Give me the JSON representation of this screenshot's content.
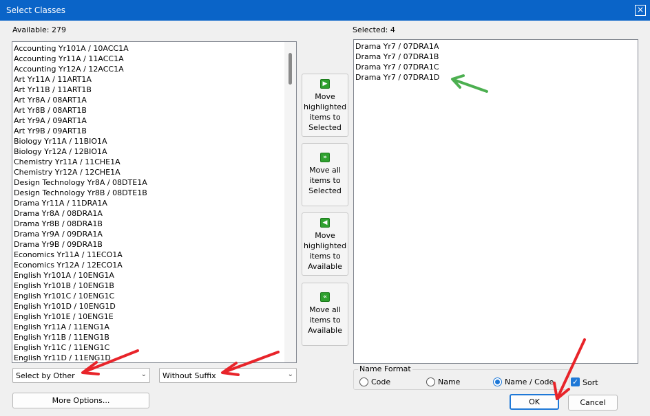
{
  "window": {
    "title": "Select Classes",
    "close_glyph": "×"
  },
  "available": {
    "label": "Available: 279",
    "items": [
      "Accounting Yr101A / 10ACC1A",
      "Accounting Yr11A / 11ACC1A",
      "Accounting Yr12A / 12ACC1A",
      "Art Yr11A / 11ART1A",
      "Art Yr11B / 11ART1B",
      "Art Yr8A / 08ART1A",
      "Art Yr8B / 08ART1B",
      "Art Yr9A / 09ART1A",
      "Art Yr9B / 09ART1B",
      "Biology Yr11A / 11BIO1A",
      "Biology Yr12A / 12BIO1A",
      "Chemistry Yr11A / 11CHE1A",
      "Chemistry Yr12A / 12CHE1A",
      "Design Technology Yr8A / 08DTE1A",
      "Design Technology Yr8B / 08DTE1B",
      "Drama Yr11A / 11DRA1A",
      "Drama Yr8A / 08DRA1A",
      "Drama Yr8B / 08DRA1B",
      "Drama Yr9A / 09DRA1A",
      "Drama Yr9B / 09DRA1B",
      "Economics Yr11A / 11ECO1A",
      "Economics Yr12A / 12ECO1A",
      "English Yr101A / 10ENG1A",
      "English Yr101B / 10ENG1B",
      "English Yr101C / 10ENG1C",
      "English Yr101D / 10ENG1D",
      "English Yr101E / 10ENG1E",
      "English Yr11A / 11ENG1A",
      "English Yr11B / 11ENG1B",
      "English Yr11C / 11ENG1C",
      "English Yr11D / 11ENG1D"
    ]
  },
  "selected": {
    "label": "Selected: 4",
    "items": [
      "Drama Yr7 / 07DRA1A",
      "Drama Yr7 / 07DRA1B",
      "Drama Yr7 / 07DRA1C",
      "Drama Yr7 / 07DRA1D"
    ]
  },
  "move_buttons": {
    "move_highlighted_to_selected": "Move highlighted items to Selected",
    "move_all_to_selected": "Move all items to Selected",
    "move_highlighted_to_available": "Move highlighted items to Available",
    "move_all_to_available": "Move all items to Available",
    "icons": [
      "arrow-right-icon",
      "double-arrow-right-icon",
      "arrow-left-icon",
      "double-arrow-left-icon"
    ]
  },
  "filters": {
    "select_by": "Select by Other",
    "suffix": "Without Suffix"
  },
  "more_options": "More Options...",
  "name_format": {
    "title": "Name Format",
    "options": [
      "Code",
      "Name",
      "Name / Code"
    ],
    "selected": "Name / Code"
  },
  "sort": {
    "label": "Sort",
    "checked": true
  },
  "ok_label": "OK",
  "cancel_label": "Cancel",
  "colors": {
    "titlebar": "#0a64c8",
    "accent": "#1e78d7",
    "annotation_red": "#e8242a",
    "annotation_green": "#4caf50"
  }
}
